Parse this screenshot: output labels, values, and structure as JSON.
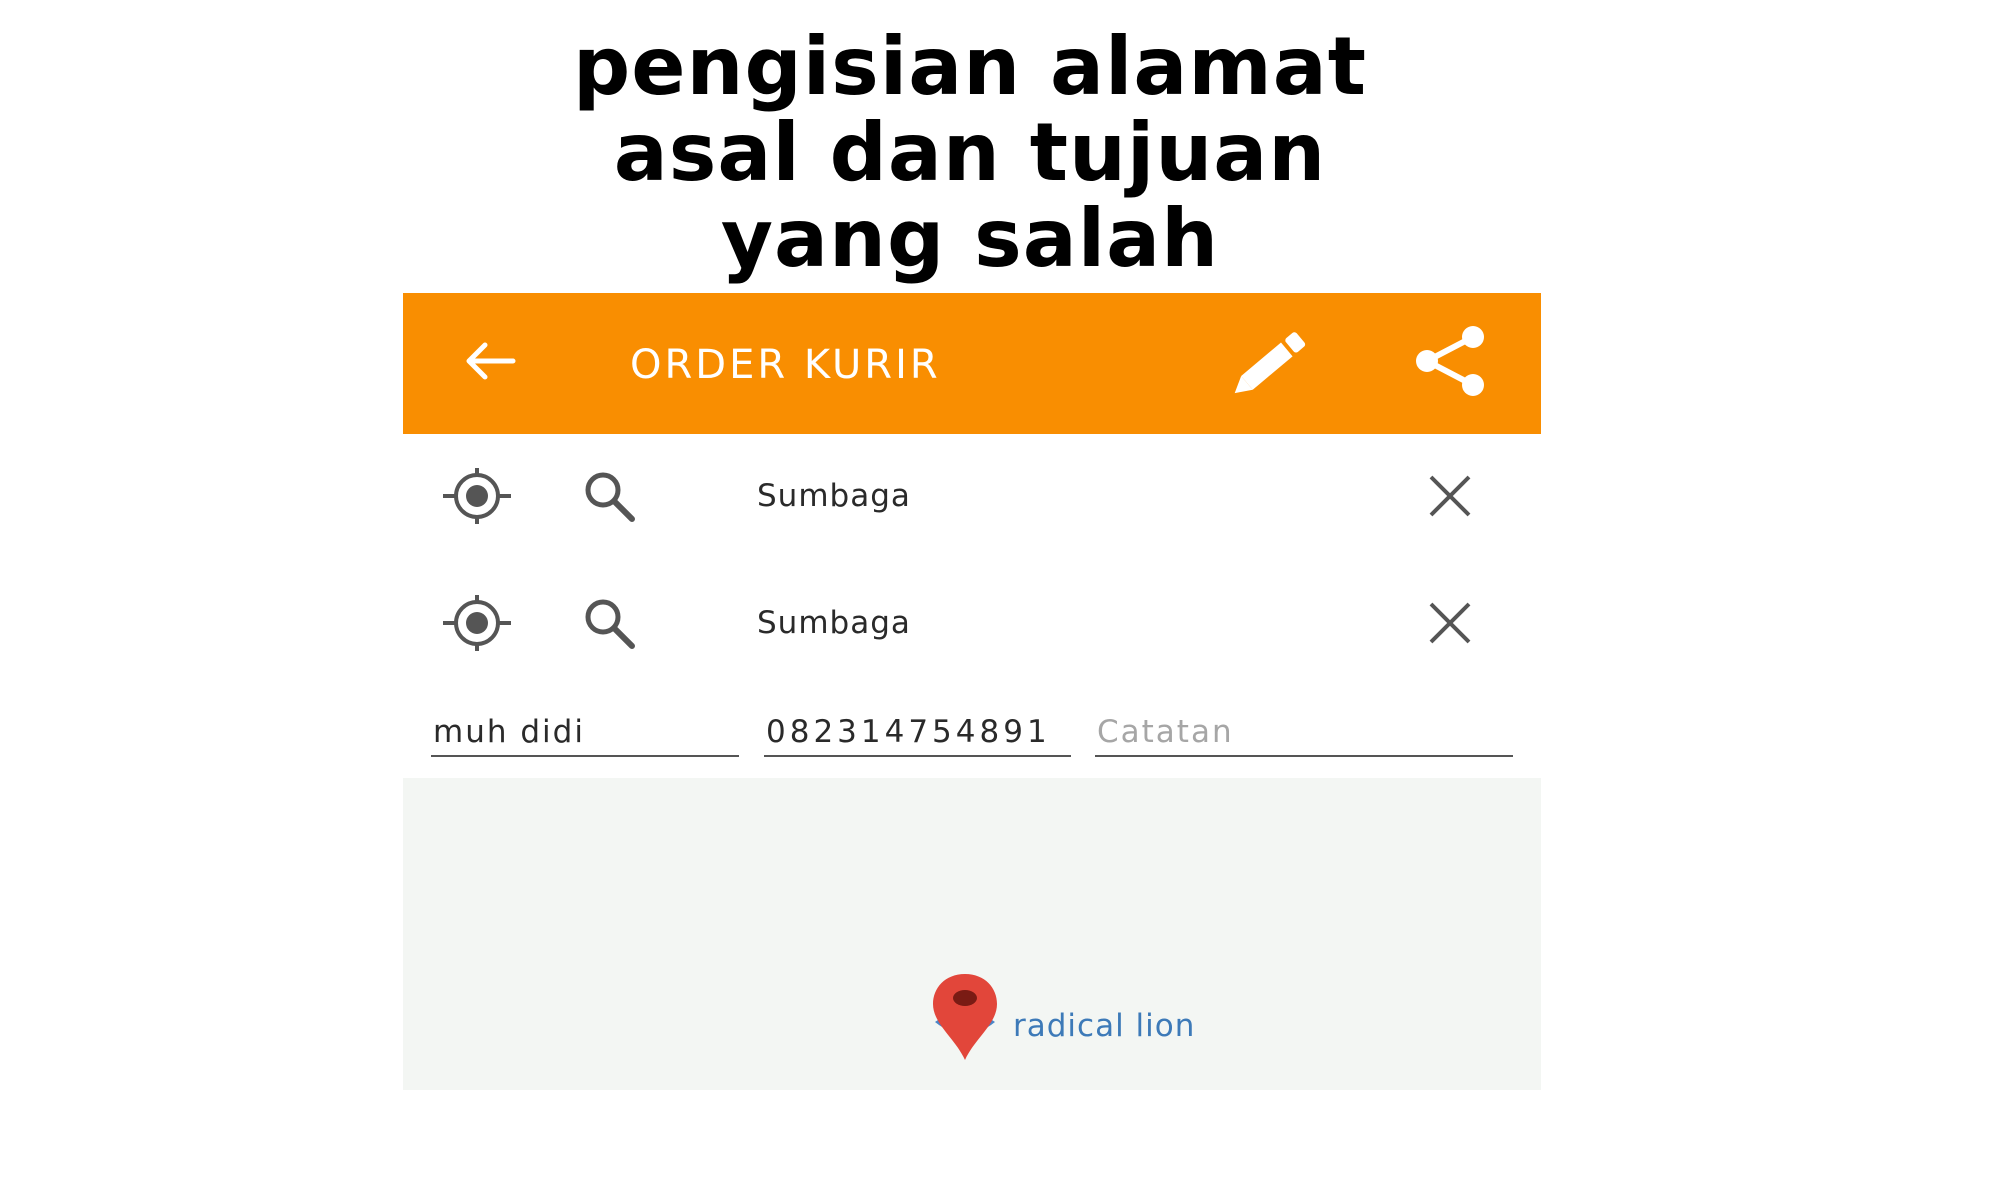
{
  "caption": {
    "line1": "pengisian alamat",
    "line2": "asal dan tujuan",
    "line3": "yang salah"
  },
  "appbar": {
    "title": "ORDER KURIR",
    "color": "#f98e01",
    "icons": [
      "arrow-back-icon",
      "pencil-icon",
      "share-icon"
    ]
  },
  "origin": {
    "value": "Sumbaga",
    "icons": [
      "target-location-icon",
      "search-icon",
      "close-icon"
    ]
  },
  "destination": {
    "value": "Sumbaga",
    "icons": [
      "target-location-icon",
      "search-icon",
      "close-icon"
    ]
  },
  "form": {
    "name": "muh didi",
    "phone": "082314754891",
    "note_placeholder": "Catatan"
  },
  "map": {
    "place_label": "radical lion",
    "pin_color": "#e2463a",
    "label_color": "#3d7ab8"
  }
}
